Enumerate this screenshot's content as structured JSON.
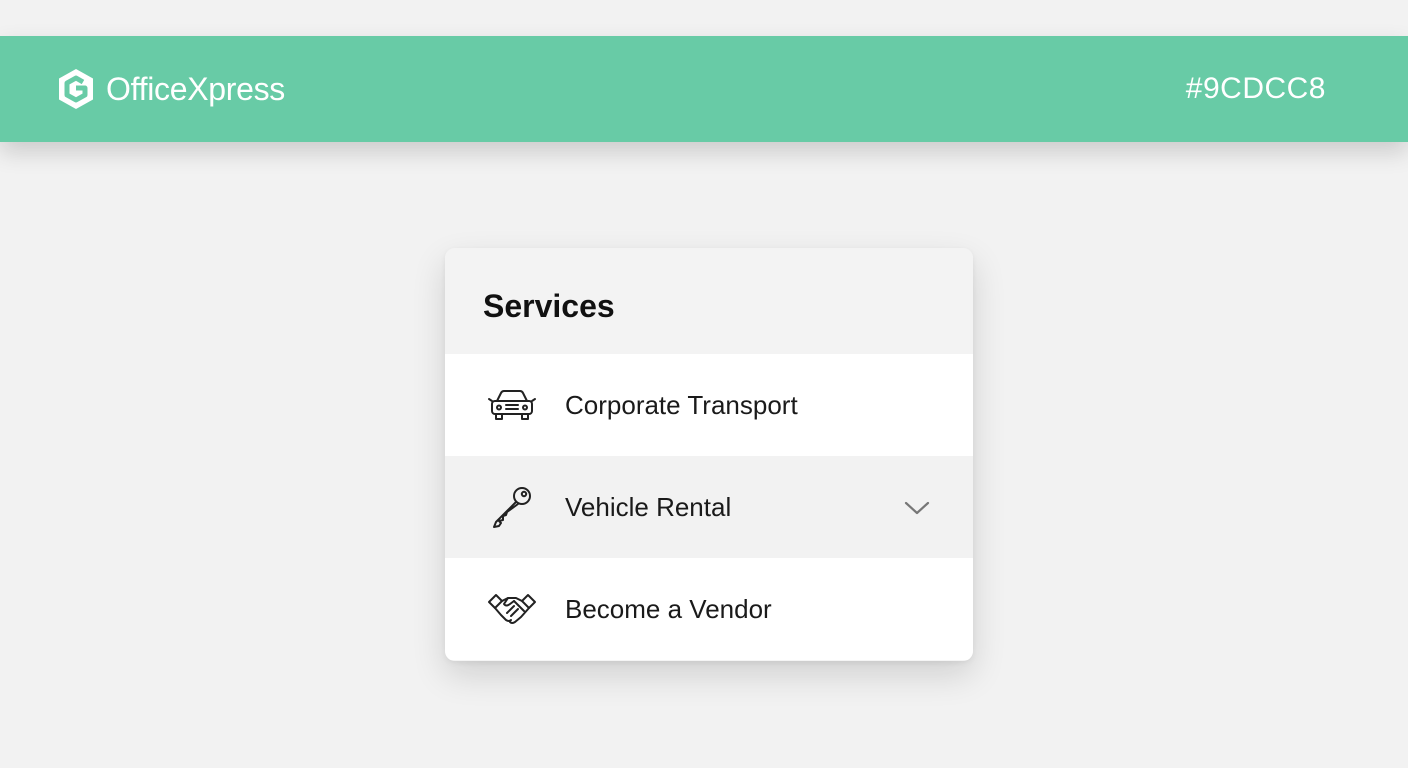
{
  "header": {
    "brand_name": "OfficeXpress",
    "color_code": "#9CDCC8",
    "logo_icon": "hexagon-g-logo-icon"
  },
  "colors": {
    "header_bg": "#68cba6",
    "page_bg": "#f2f2f2",
    "card_bg": "#ffffff"
  },
  "menu": {
    "title": "Services",
    "items": [
      {
        "label": "Corporate Transport",
        "icon": "car-icon"
      },
      {
        "label": "Vehicle Rental",
        "icon": "key-icon",
        "expandable": true
      },
      {
        "label": "Become a Vendor",
        "icon": "handshake-icon"
      }
    ]
  }
}
